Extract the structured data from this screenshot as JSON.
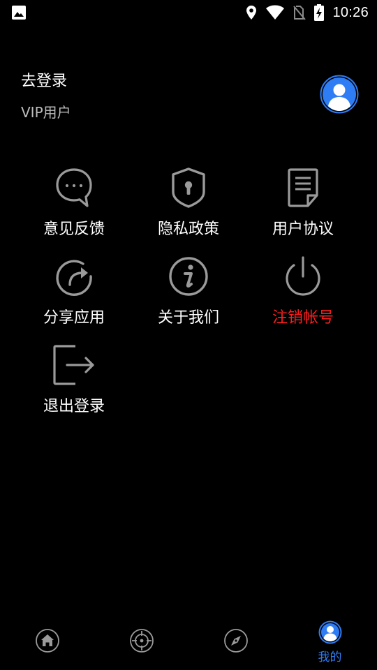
{
  "status_bar": {
    "time": "10:26",
    "icons": [
      "image-icon",
      "location-icon",
      "wifi-icon",
      "no-sim-icon",
      "battery-charging-icon"
    ]
  },
  "profile": {
    "login_text": "去登录",
    "membership_text": "VIP用户",
    "avatar_icon": "user-avatar-icon"
  },
  "menu": {
    "items": [
      {
        "label": "意见反馈",
        "icon": "feedback-chat-icon"
      },
      {
        "label": "隐私政策",
        "icon": "privacy-shield-icon"
      },
      {
        "label": "用户协议",
        "icon": "agreement-document-icon"
      },
      {
        "label": "分享应用",
        "icon": "share-refresh-icon"
      },
      {
        "label": "关于我们",
        "icon": "info-icon"
      },
      {
        "label": "注销帐号",
        "icon": "power-icon",
        "danger": true
      },
      {
        "label": "退出登录",
        "icon": "logout-icon"
      }
    ]
  },
  "bottom_nav": {
    "items": [
      {
        "icon": "home-icon",
        "label": ""
      },
      {
        "icon": "crosshair-icon",
        "label": ""
      },
      {
        "icon": "compass-icon",
        "label": ""
      },
      {
        "icon": "profile-icon",
        "label": "我的",
        "active": true
      }
    ]
  },
  "colors": {
    "background": "#000000",
    "text": "#ffffff",
    "secondary_text": "#bdbdbd",
    "icon_gray": "#9a9a9a",
    "accent": "#2f7df5",
    "danger": "#ff1e1e"
  }
}
